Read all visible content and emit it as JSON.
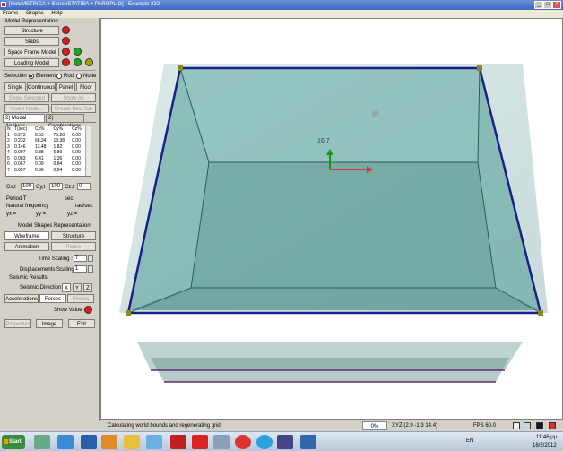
{
  "window": {
    "title": "[HoloMETRICA + StereoSTATIBA + PAROPLIG] - Example 232",
    "controls": [
      "_",
      "□",
      "×"
    ]
  },
  "menu": [
    "Frame",
    "Graphs",
    "Help"
  ],
  "model_representation": {
    "title": "Model Representation",
    "items": [
      {
        "label": "Structure"
      },
      {
        "label": "Slabs"
      },
      {
        "label": "Space Frame Model"
      },
      {
        "label": "Loading Model"
      }
    ]
  },
  "selection": {
    "label": "Selection",
    "options": [
      "Element",
      "Rod",
      "Node"
    ],
    "selected": "Element",
    "buttons": [
      "Single",
      "Continuous",
      "Panel",
      "Floor"
    ],
    "buttons2": [
      "Show Selected",
      "Show All"
    ],
    "buttons3": [
      "Insert Node...",
      "Create New Bar"
    ]
  },
  "tabs": [
    {
      "label": "2) Modal Analysis"
    },
    {
      "label": "2) Combinations"
    }
  ],
  "modal_table": {
    "headers": [
      "N",
      "T(sec)",
      "Cx%",
      "Cy%",
      "Cz%"
    ],
    "rows": [
      [
        "1",
        "0.273",
        "8.53",
        "75.28",
        "0.00"
      ],
      [
        "2",
        "0.232",
        "68.34",
        "13.38",
        "0.00"
      ],
      [
        "3",
        "0.146",
        "13.48",
        "1.82",
        "0.00"
      ],
      [
        "4",
        "0.097",
        "0.88",
        "6.89",
        "0.00"
      ],
      [
        "5",
        "0.083",
        "6.41",
        "1.36",
        "0.00"
      ],
      [
        "6",
        "0.067",
        "0.09",
        "0.84",
        "0.00"
      ],
      [
        "7",
        "0.057",
        "0.66",
        "0.24",
        "0.00"
      ]
    ]
  },
  "sums": {
    "cx_label": "Cx,t",
    "cx_value": "100",
    "cy_label": "Cy,t",
    "cy_value": "100",
    "cz_label": "Cz,t",
    "cz_value": "0"
  },
  "period": {
    "period_label": "Period T",
    "period_unit": "sec",
    "freq_label": "Natural frequency",
    "freq_unit": "rad/sec",
    "yx_label": "yx =",
    "yy_label": "yy =",
    "yz_label": "yz ="
  },
  "shapes": {
    "title": "Model Shapes Representation",
    "wireframe": "Wireframe",
    "structure": "Structure",
    "animation": "Animation",
    "pause": "Pause",
    "time_scaling_label": "Time Scaling :",
    "time_scaling_value": "7",
    "disp_scaling_label": "Displacements Scaling :",
    "disp_scaling_value": "1"
  },
  "seismic": {
    "title": "Seismic Results",
    "direction_label": "Seismic Direction :",
    "directions": [
      "X",
      "Y",
      "Z"
    ],
    "buttons": [
      "Accelerations",
      "Forces",
      "Shears"
    ],
    "show_value_label": "Show Value :"
  },
  "bottom_buttons": [
    "Properties",
    "Image",
    "Exit"
  ],
  "viewport": {
    "axis_label": "16.7"
  },
  "status": {
    "message": "Calculating world bounds and regenerating grid",
    "progress": "0%",
    "xyz": "XYZ (2.9 -1.3 14.4)",
    "fps": "FPS 60.0"
  },
  "taskbar": {
    "start": "Start",
    "lang": "EN",
    "time": "11:46 μμ",
    "date": "16/2/2012"
  },
  "colors": {
    "glass": "#3c8f8a",
    "frame_blue": "#1a1f8c",
    "red_indicator": "#e8141b",
    "green_indicator": "#1ea81e"
  }
}
